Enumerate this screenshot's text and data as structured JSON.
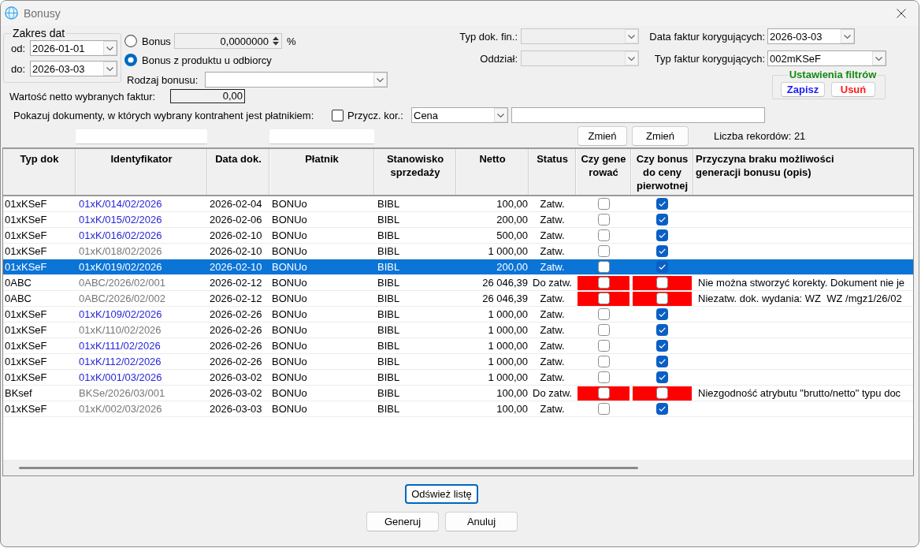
{
  "window": {
    "title": "Bonusy"
  },
  "date_range": {
    "title": "Zakres dat",
    "from": {
      "label": "od:",
      "value": "2026-01-01"
    },
    "to": {
      "label": "do:",
      "value": "2026-03-03"
    }
  },
  "bonus_mode": {
    "options": [
      {
        "label": "Bonus",
        "selected": false
      },
      {
        "label": "Bonus z produktu u odbiorcy",
        "selected": true
      }
    ]
  },
  "bonus_value": {
    "value": "0,0000000",
    "unit": "%",
    "disabled": true
  },
  "bonus_type": {
    "label": "Rodzaj bonusu:",
    "disabled": false
  },
  "net_value": {
    "label": "Wartość netto wybranych faktur:",
    "value": "0,00"
  },
  "fin_doc_type": {
    "label": "Typ dok. fin.:",
    "disabled": true
  },
  "correction_date": {
    "label": "Data faktur korygujących:",
    "value": "2026-03-03"
  },
  "branch": {
    "label": "Oddział:",
    "disabled": true
  },
  "correction_type": {
    "label": "Typ faktur korygujących:",
    "value": "002mKSeF"
  },
  "filter_settings": {
    "title": "Ustawienia filtrów",
    "buttons": [
      {
        "label": "Zapisz",
        "kind": "save"
      },
      {
        "label": "Usuń",
        "kind": "delete"
      }
    ]
  },
  "payer_filter": {
    "label": "Pokazuj dokumenty, w których wybrany kontrahent jest płatnikiem:",
    "checked": false
  },
  "correction_reason": {
    "label": "Przycz. kor.:",
    "value": "Cena"
  },
  "change_buttons": [
    "Zmień",
    "Zmień"
  ],
  "record_count": "Liczba rekordów: 21",
  "table": {
    "columns": [
      "Typ dok",
      "Identyfikator",
      "Data dok.",
      "Płatnik",
      "Stanowisko\nsprzedaży",
      "Netto",
      "Status",
      "Czy gene\nrować",
      "Czy bonus\ndo ceny\npierwotnej",
      "Przyczyna braku możliwości\ngeneracji bonusu (opis)"
    ],
    "rows": [
      {
        "typ_dok": "01xKSeF",
        "identyfikator": {
          "text": "01xK/014/02/2026",
          "color": "#2626d9"
        },
        "data_dok": "2026-02-04",
        "platnik": "BONUo",
        "stanowisko": "BIBL",
        "netto": "100,00",
        "status": "Zatw.",
        "generate_checked": false,
        "base_price_checked": true,
        "error": false,
        "selected": false
      },
      {
        "typ_dok": "01xKSeF",
        "identyfikator": {
          "text": "01xK/015/02/2026",
          "color": "#2626d9"
        },
        "data_dok": "2026-02-06",
        "platnik": "BONUo",
        "stanowisko": "BIBL",
        "netto": "200,00",
        "status": "Zatw.",
        "generate_checked": false,
        "base_price_checked": true,
        "error": false,
        "selected": false
      },
      {
        "typ_dok": "01xKSeF",
        "identyfikator": {
          "text": "01xK/016/02/2026",
          "color": "#2626d9"
        },
        "data_dok": "2026-02-10",
        "platnik": "BONUo",
        "stanowisko": "BIBL",
        "netto": "500,00",
        "status": "Zatw.",
        "generate_checked": false,
        "base_price_checked": true,
        "error": false,
        "selected": false
      },
      {
        "typ_dok": "01xKSeF",
        "identyfikator": {
          "text": "01xK/018/02/2026",
          "color": "#777777"
        },
        "data_dok": "2026-02-10",
        "platnik": "BONUo",
        "stanowisko": "BIBL",
        "netto": "1 000,00",
        "status": "Zatw.",
        "generate_checked": false,
        "base_price_checked": true,
        "error": false,
        "selected": false
      },
      {
        "typ_dok": "01xKSeF",
        "identyfikator": {
          "text": "01xK/019/02/2026"
        },
        "data_dok": "2026-02-10",
        "platnik": "BONUo",
        "stanowisko": "BIBL",
        "netto": "200,00",
        "status": "Zatw.",
        "generate_checked": false,
        "base_price_checked": true,
        "error": false,
        "selected": true
      },
      {
        "typ_dok": "0ABC",
        "identyfikator": {
          "text": "0ABC/2026/02/001",
          "color": "#777777"
        },
        "data_dok": "2026-02-12",
        "platnik": "BONUo",
        "stanowisko": "BIBL",
        "netto": "26 046,39",
        "status": "Do zatw.",
        "generate_checked": false,
        "base_price_checked": false,
        "error": true,
        "przyczyna": "Nie można stworzyć korekty. Dokument nie je",
        "selected": false
      },
      {
        "typ_dok": "0ABC",
        "identyfikator": {
          "text": "0ABC/2026/02/002",
          "color": "#777777"
        },
        "data_dok": "2026-02-12",
        "platnik": "BONUo",
        "stanowisko": "BIBL",
        "netto": "26 046,39",
        "status": "Zatw.",
        "generate_checked": false,
        "base_price_checked": false,
        "error": true,
        "przyczyna": "Niezatw. dok. wydania: WZ  WZ /mgz1/26/02",
        "selected": false
      },
      {
        "typ_dok": "01xKSeF",
        "identyfikator": {
          "text": "01xK/109/02/2026",
          "color": "#2626d9"
        },
        "data_dok": "2026-02-26",
        "platnik": "BONUo",
        "stanowisko": "BIBL",
        "netto": "1 000,00",
        "status": "Zatw.",
        "generate_checked": false,
        "base_price_checked": true,
        "error": false,
        "selected": false
      },
      {
        "typ_dok": "01xKSeF",
        "identyfikator": {
          "text": "01xK/110/02/2026",
          "color": "#777777"
        },
        "data_dok": "2026-02-26",
        "platnik": "BONUo",
        "stanowisko": "BIBL",
        "netto": "1 000,00",
        "status": "Zatw.",
        "generate_checked": false,
        "base_price_checked": true,
        "error": false,
        "selected": false
      },
      {
        "typ_dok": "01xKSeF",
        "identyfikator": {
          "text": "01xK/111/02/2026",
          "color": "#2626d9"
        },
        "data_dok": "2026-02-26",
        "platnik": "BONUo",
        "stanowisko": "BIBL",
        "netto": "1 000,00",
        "status": "Zatw.",
        "generate_checked": false,
        "base_price_checked": true,
        "error": false,
        "selected": false
      },
      {
        "typ_dok": "01xKSeF",
        "identyfikator": {
          "text": "01xK/112/02/2026",
          "color": "#2626d9"
        },
        "data_dok": "2026-02-26",
        "platnik": "BONUo",
        "stanowisko": "BIBL",
        "netto": "1 000,00",
        "status": "Zatw.",
        "generate_checked": false,
        "base_price_checked": true,
        "error": false,
        "selected": false
      },
      {
        "typ_dok": "01xKSeF",
        "identyfikator": {
          "text": "01xK/001/03/2026",
          "color": "#2626d9"
        },
        "data_dok": "2026-03-02",
        "platnik": "BONUo",
        "stanowisko": "BIBL",
        "netto": "1 000,00",
        "status": "Zatw.",
        "generate_checked": false,
        "base_price_checked": true,
        "error": false,
        "selected": false
      },
      {
        "typ_dok": "BKsef",
        "identyfikator": {
          "text": "BKSe/2026/03/001",
          "color": "#777777"
        },
        "data_dok": "2026-03-02",
        "platnik": "BONUo",
        "stanowisko": "BIBL",
        "netto": "100,00",
        "status": "Do zatw.",
        "generate_checked": false,
        "base_price_checked": false,
        "error": true,
        "przyczyna": "Niezgodność atrybutu \"brutto/netto\" typu doc",
        "selected": false
      },
      {
        "typ_dok": "01xKSeF",
        "identyfikator": {
          "text": "01xK/002/03/2026",
          "color": "#777777"
        },
        "data_dok": "2026-03-03",
        "platnik": "BONUo",
        "stanowisko": "BIBL",
        "netto": "100,00",
        "status": "Zatw.",
        "generate_checked": false,
        "base_price_checked": true,
        "error": false,
        "selected": false
      }
    ]
  },
  "refresh_button": {
    "label": "Odśwież listę",
    "focused": true
  },
  "action_buttons": [
    {
      "label": "Generuj",
      "focused": false
    },
    {
      "label": "Anuluj",
      "focused": false
    }
  ]
}
